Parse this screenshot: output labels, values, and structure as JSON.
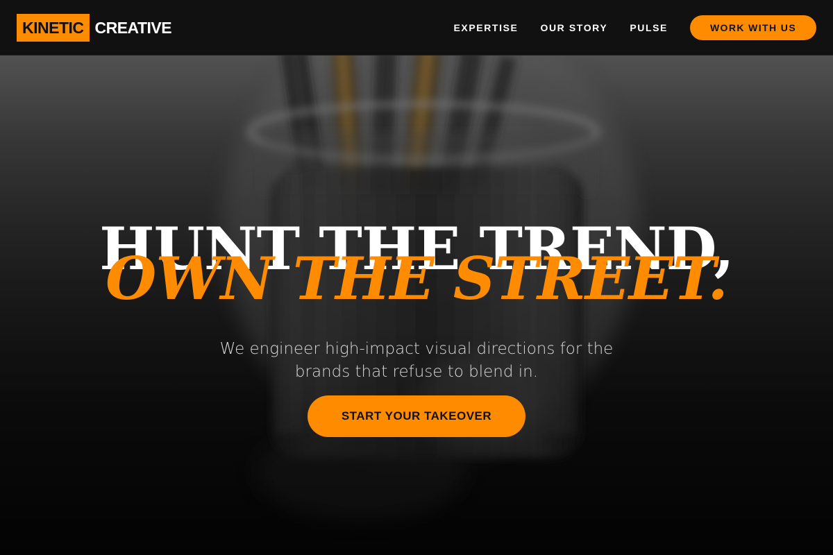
{
  "brand": {
    "box_text": "KINETIC",
    "text": "CREATIVE",
    "accent_color": "#ff8c00"
  },
  "nav": {
    "links": [
      "EXPERTISE",
      "OUR STORY",
      "PULSE"
    ],
    "cta_label": "WORK WITH US"
  },
  "hero": {
    "headline_line1": "HUNT THE TREND,",
    "headline_line2": "OWN THE STREET.",
    "subtitle": "We engineer high-impact visual directions for the brands that refuse to blend in.",
    "cta_label": "START YOUR TAKEOVER",
    "background_image": "paint-brushes-in-glass-jar-photo"
  }
}
